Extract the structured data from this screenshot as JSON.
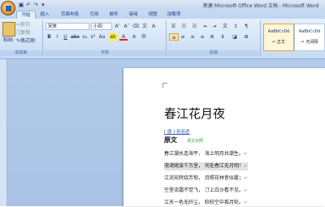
{
  "window": {
    "title": "新建 Microsoft Office Word 文档 - Microsoft Word"
  },
  "tabs": [
    "开始",
    "插入",
    "页面布局",
    "引用",
    "邮件",
    "审阅",
    "视图",
    "加载项"
  ],
  "active_tab": "开始",
  "clipboard": {
    "paste_label": "粘贴",
    "cut_label": "剪切",
    "copy_label": "复制",
    "format_painter_label": "格式刷",
    "group_label": "剪贴板"
  },
  "font": {
    "family": "宋体",
    "size": "小四",
    "group_label": "字体"
  },
  "paragraph": {
    "group_label": "段落"
  },
  "styles": [
    {
      "sample": "AaBbCcDd",
      "name": "正文",
      "active": true
    },
    {
      "sample": "AaBbCcDd",
      "name": "无间隔",
      "active": false
    }
  ],
  "document": {
    "title": "春江花月夜",
    "author": "[ 唐 ] 张若虚",
    "section_heading": "原文",
    "translate_link": "译文对照",
    "lines": [
      "春江潮水连海平，  海上明月共潮生。",
      "滟滟随波千万里，  何处春江无月明！",
      "江流宛转绕芳甸，  月照花林皆似霰；",
      "空里流霜不觉飞，  汀上白沙看不见。",
      "江天一色无纤尘，  皎皎空中孤月轮。"
    ]
  },
  "colors": {
    "ribbon": "#d6e5f6",
    "workspace": "#abc4e5",
    "link": "#2e5fb0",
    "translate_link": "#2c9c3a"
  }
}
